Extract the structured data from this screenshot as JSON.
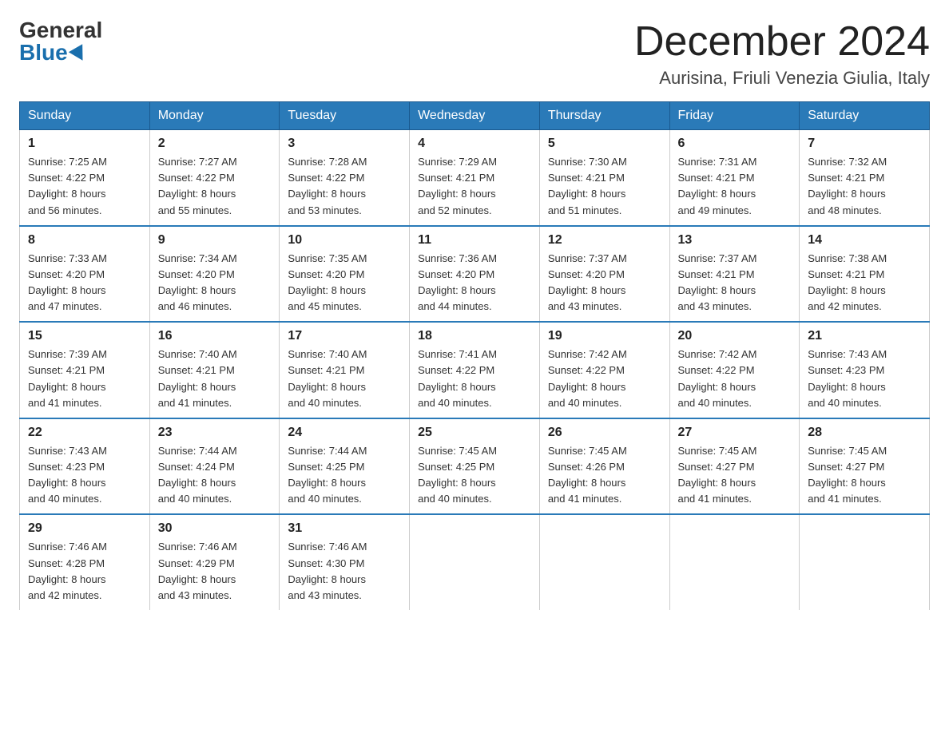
{
  "header": {
    "logo_general": "General",
    "logo_blue": "Blue",
    "month_title": "December 2024",
    "location": "Aurisina, Friuli Venezia Giulia, Italy"
  },
  "days_of_week": [
    "Sunday",
    "Monday",
    "Tuesday",
    "Wednesday",
    "Thursday",
    "Friday",
    "Saturday"
  ],
  "weeks": [
    [
      {
        "day": "1",
        "sunrise": "7:25 AM",
        "sunset": "4:22 PM",
        "daylight": "8 hours and 56 minutes."
      },
      {
        "day": "2",
        "sunrise": "7:27 AM",
        "sunset": "4:22 PM",
        "daylight": "8 hours and 55 minutes."
      },
      {
        "day": "3",
        "sunrise": "7:28 AM",
        "sunset": "4:22 PM",
        "daylight": "8 hours and 53 minutes."
      },
      {
        "day": "4",
        "sunrise": "7:29 AM",
        "sunset": "4:21 PM",
        "daylight": "8 hours and 52 minutes."
      },
      {
        "day": "5",
        "sunrise": "7:30 AM",
        "sunset": "4:21 PM",
        "daylight": "8 hours and 51 minutes."
      },
      {
        "day": "6",
        "sunrise": "7:31 AM",
        "sunset": "4:21 PM",
        "daylight": "8 hours and 49 minutes."
      },
      {
        "day": "7",
        "sunrise": "7:32 AM",
        "sunset": "4:21 PM",
        "daylight": "8 hours and 48 minutes."
      }
    ],
    [
      {
        "day": "8",
        "sunrise": "7:33 AM",
        "sunset": "4:20 PM",
        "daylight": "8 hours and 47 minutes."
      },
      {
        "day": "9",
        "sunrise": "7:34 AM",
        "sunset": "4:20 PM",
        "daylight": "8 hours and 46 minutes."
      },
      {
        "day": "10",
        "sunrise": "7:35 AM",
        "sunset": "4:20 PM",
        "daylight": "8 hours and 45 minutes."
      },
      {
        "day": "11",
        "sunrise": "7:36 AM",
        "sunset": "4:20 PM",
        "daylight": "8 hours and 44 minutes."
      },
      {
        "day": "12",
        "sunrise": "7:37 AM",
        "sunset": "4:20 PM",
        "daylight": "8 hours and 43 minutes."
      },
      {
        "day": "13",
        "sunrise": "7:37 AM",
        "sunset": "4:21 PM",
        "daylight": "8 hours and 43 minutes."
      },
      {
        "day": "14",
        "sunrise": "7:38 AM",
        "sunset": "4:21 PM",
        "daylight": "8 hours and 42 minutes."
      }
    ],
    [
      {
        "day": "15",
        "sunrise": "7:39 AM",
        "sunset": "4:21 PM",
        "daylight": "8 hours and 41 minutes."
      },
      {
        "day": "16",
        "sunrise": "7:40 AM",
        "sunset": "4:21 PM",
        "daylight": "8 hours and 41 minutes."
      },
      {
        "day": "17",
        "sunrise": "7:40 AM",
        "sunset": "4:21 PM",
        "daylight": "8 hours and 40 minutes."
      },
      {
        "day": "18",
        "sunrise": "7:41 AM",
        "sunset": "4:22 PM",
        "daylight": "8 hours and 40 minutes."
      },
      {
        "day": "19",
        "sunrise": "7:42 AM",
        "sunset": "4:22 PM",
        "daylight": "8 hours and 40 minutes."
      },
      {
        "day": "20",
        "sunrise": "7:42 AM",
        "sunset": "4:22 PM",
        "daylight": "8 hours and 40 minutes."
      },
      {
        "day": "21",
        "sunrise": "7:43 AM",
        "sunset": "4:23 PM",
        "daylight": "8 hours and 40 minutes."
      }
    ],
    [
      {
        "day": "22",
        "sunrise": "7:43 AM",
        "sunset": "4:23 PM",
        "daylight": "8 hours and 40 minutes."
      },
      {
        "day": "23",
        "sunrise": "7:44 AM",
        "sunset": "4:24 PM",
        "daylight": "8 hours and 40 minutes."
      },
      {
        "day": "24",
        "sunrise": "7:44 AM",
        "sunset": "4:25 PM",
        "daylight": "8 hours and 40 minutes."
      },
      {
        "day": "25",
        "sunrise": "7:45 AM",
        "sunset": "4:25 PM",
        "daylight": "8 hours and 40 minutes."
      },
      {
        "day": "26",
        "sunrise": "7:45 AM",
        "sunset": "4:26 PM",
        "daylight": "8 hours and 41 minutes."
      },
      {
        "day": "27",
        "sunrise": "7:45 AM",
        "sunset": "4:27 PM",
        "daylight": "8 hours and 41 minutes."
      },
      {
        "day": "28",
        "sunrise": "7:45 AM",
        "sunset": "4:27 PM",
        "daylight": "8 hours and 41 minutes."
      }
    ],
    [
      {
        "day": "29",
        "sunrise": "7:46 AM",
        "sunset": "4:28 PM",
        "daylight": "8 hours and 42 minutes."
      },
      {
        "day": "30",
        "sunrise": "7:46 AM",
        "sunset": "4:29 PM",
        "daylight": "8 hours and 43 minutes."
      },
      {
        "day": "31",
        "sunrise": "7:46 AM",
        "sunset": "4:30 PM",
        "daylight": "8 hours and 43 minutes."
      },
      null,
      null,
      null,
      null
    ]
  ],
  "labels": {
    "sunrise": "Sunrise:",
    "sunset": "Sunset:",
    "daylight": "Daylight:"
  }
}
